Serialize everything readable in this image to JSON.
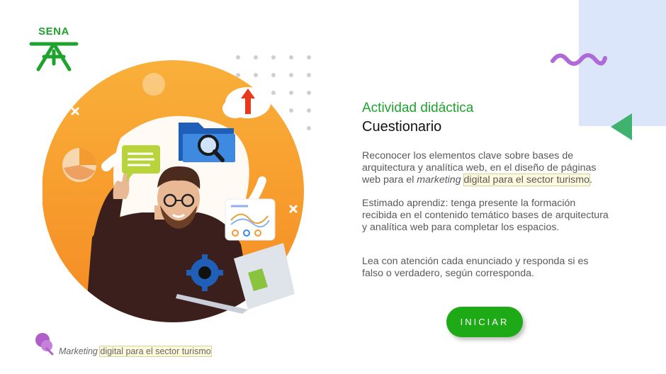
{
  "brand": {
    "logo_text": "SENA",
    "color": "#1fa32f"
  },
  "activity": {
    "kind": "Actividad didáctica",
    "title": "Cuestionario"
  },
  "paragraphs": {
    "p1_a": "Reconocer los elementos clave sobre bases de arquitectura y analítica web, en el diseño de páginas web para el ",
    "p1_italic": "marketing",
    "p1_space": " ",
    "p1_highlight": "digital para el sector turismo",
    "p1_end": ".",
    "p2": "Estimado aprendiz: tenga presente la formación recibida en el contenido temático bases de arquitectura y analítica web para completar los espacios.",
    "p3": "Lea con atención cada enunciado y responda si es falso o verdadero, según corresponda."
  },
  "start_button": {
    "label": "INICIAR",
    "color": "#1eaa17"
  },
  "footer": {
    "italic": "Marketing",
    "space": " ",
    "highlight": "digital para el sector turismo"
  },
  "colors": {
    "orange": "#f7a52e",
    "blue_panel": "#dbe6fb",
    "purple": "#b06ad8",
    "triangle_green": "#3fb36e"
  },
  "icons": [
    "pie-chart-icon",
    "chat-bubble-icon",
    "folder-search-icon",
    "upload-cloud-icon",
    "analytics-card-icon",
    "gear-icon",
    "laptop-icon",
    "pin-icon",
    "close-icon"
  ]
}
